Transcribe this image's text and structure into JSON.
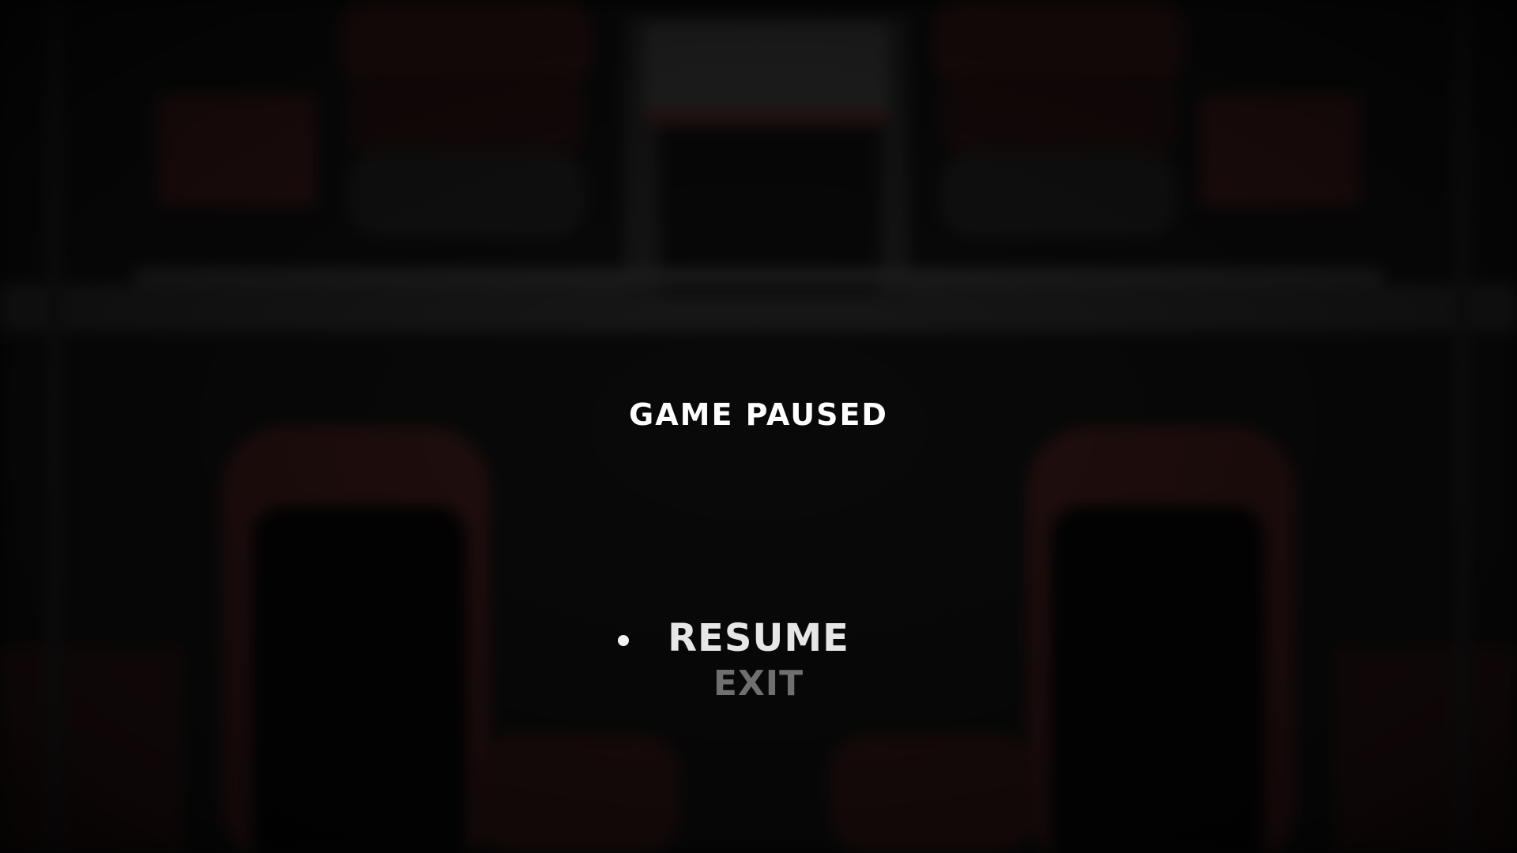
{
  "pause_menu": {
    "title": "GAME PAUSED",
    "items": [
      {
        "label": "RESUME",
        "selected": true
      },
      {
        "label": "EXIT",
        "selected": false
      }
    ]
  },
  "colors": {
    "title": "#ffffff",
    "selected_item": "#e6e6e6",
    "unselected_item": "#6f6f6f",
    "seat_red": "#3a1414",
    "background": "#080808"
  }
}
